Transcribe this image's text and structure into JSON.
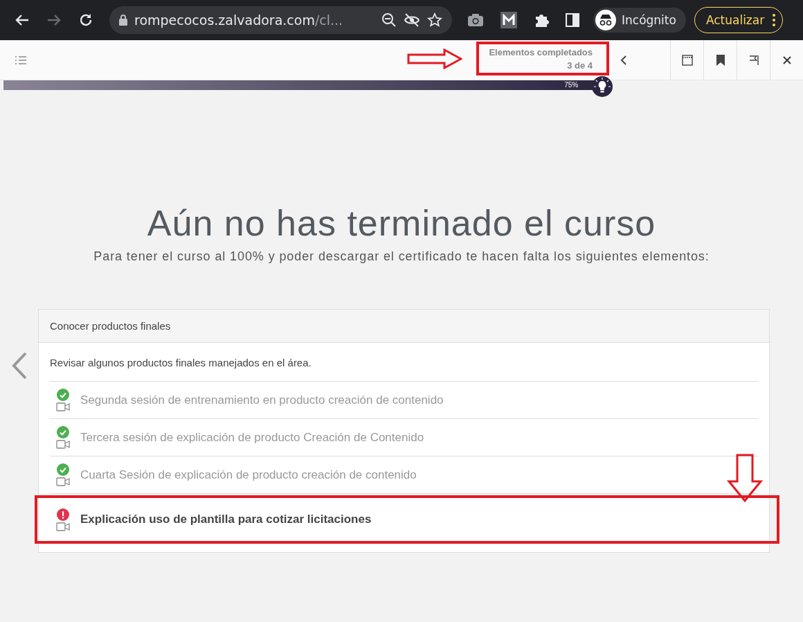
{
  "browser": {
    "url_host": "rompecocos.zalvadora.com",
    "url_path": "/cl...",
    "profile": "Incógnito",
    "update_button": "Actualizar"
  },
  "toolbar": {
    "completed_label": "Elementos completados",
    "completed_count": "3 de 4"
  },
  "progress": {
    "level": 0.75,
    "reading": "75%"
  },
  "heading": "Aún no has terminado el curso",
  "subtitle": "Para tener el curso al 100% y poder descargar el certificado te hacen falta los siguientes elementos:",
  "card": {
    "title": "Conocer productos finales",
    "description": "Revisar algunos productos finales manejados en el área.",
    "items": [
      {
        "label": "Segunda sesión de entrenamiento en producto creación de contenido",
        "completed": true,
        "highlighted": false
      },
      {
        "label": "Tercera sesión de explicación de producto Creación de Contenido",
        "completed": true,
        "highlighted": false
      },
      {
        "label": "Cuarta Sesión de explicación de producto creación de contenido",
        "completed": true,
        "highlighted": false
      },
      {
        "label": "Explicación uso de plantilla para cotizar licitaciones",
        "completed": false,
        "highlighted": true
      }
    ]
  }
}
